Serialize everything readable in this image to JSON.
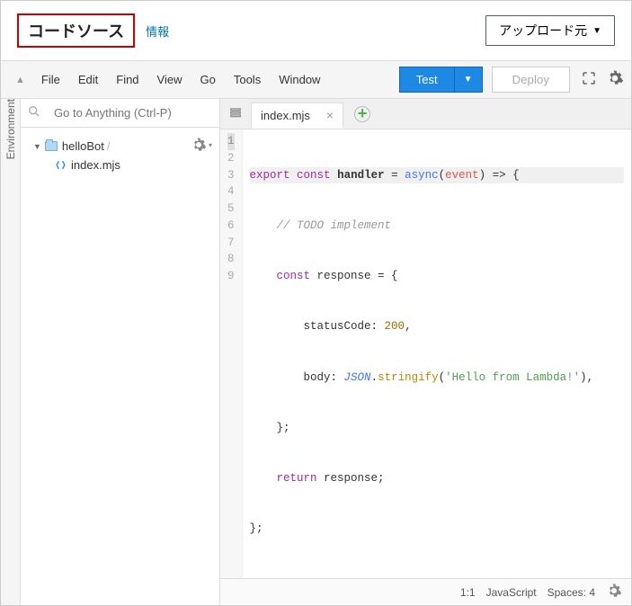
{
  "header": {
    "title": "コードソース",
    "info_label": "情報",
    "upload_label": "アップロード元"
  },
  "menu": {
    "items": [
      "File",
      "Edit",
      "Find",
      "View",
      "Go",
      "Tools",
      "Window"
    ],
    "test_label": "Test",
    "deploy_label": "Deploy"
  },
  "sidebar": {
    "env_label": "Environment",
    "search_placeholder": "Go to Anything (Ctrl-P)",
    "folder_name": "helloBot",
    "file_name": "index.mjs"
  },
  "tabs": {
    "active": "index.mjs"
  },
  "code": {
    "line_count": 9,
    "l1": {
      "export": "export",
      "const": "const",
      "handler": " handler ",
      "eq": "= ",
      "async": "async",
      "open": "(",
      "event": "event",
      "close": ") ",
      "arrow": "=> {"
    },
    "l2": {
      "indent": "    ",
      "comment": "// TODO implement"
    },
    "l3": {
      "indent": "    ",
      "const": "const",
      "rest": " response = {"
    },
    "l4": {
      "indent": "        ",
      "key": "statusCode: ",
      "val": "200",
      "comma": ","
    },
    "l5": {
      "indent": "        ",
      "key": "body: ",
      "obj": "JSON",
      "dot": ".",
      "method": "stringify",
      "open": "(",
      "str": "'Hello from Lambda!'",
      "close": "),"
    },
    "l6": {
      "text": "    };"
    },
    "l7": {
      "indent": "    ",
      "return": "return",
      "rest": " response;"
    },
    "l8": {
      "text": "};"
    }
  },
  "status": {
    "pos": "1:1",
    "lang": "JavaScript",
    "spaces": "Spaces: 4"
  }
}
